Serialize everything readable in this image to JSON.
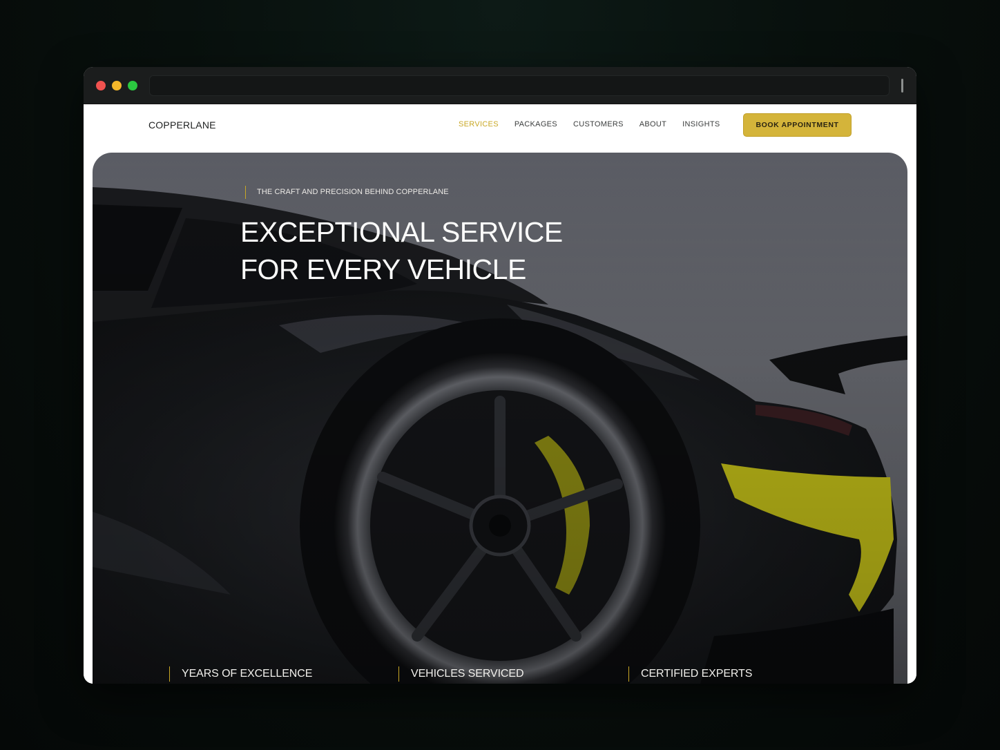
{
  "nav": {
    "logo": "COPPERLANE",
    "links": [
      "SERVICES",
      "PACKAGES",
      "CUSTOMERS",
      "ABOUT",
      "INSIGHTS"
    ],
    "active": "SERVICES",
    "cta": "BOOK APPOINTMENT"
  },
  "hero": {
    "eyebrow": "THE CRAFT AND PRECISION BEHIND COPPERLANE",
    "headline_line1": "EXCEPTIONAL SERVICE",
    "headline_line2": "FOR EVERY VEHICLE"
  },
  "stats": [
    "YEARS OF EXCELLENCE",
    "VEHICLES SERVICED",
    "CERTIFIED EXPERTS"
  ],
  "colors": {
    "accent": "#d4b43a",
    "active_link": "#c9a825",
    "car_highlight": "#c8c419"
  }
}
